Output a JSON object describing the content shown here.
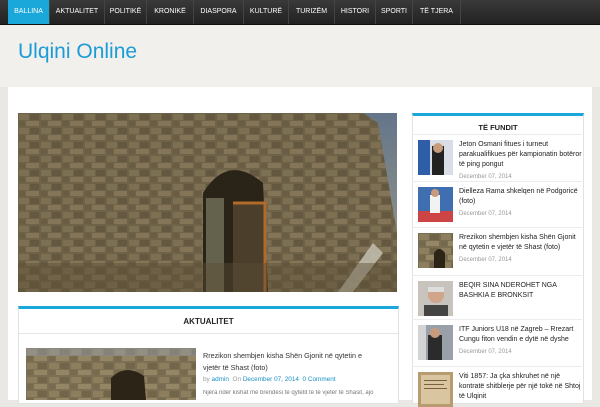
{
  "nav": {
    "items": [
      "BALLINA",
      "AKTUALITET",
      "POLITIKË",
      "KRONIKË",
      "DIASPORA",
      "KULTURË",
      "TURIZËM",
      "HISTORI",
      "SPORTI",
      "TË TJERA"
    ],
    "active_index": 0,
    "active_color": "#1aa7d9"
  },
  "site": {
    "title": "Ulqini Online",
    "title_color": "#1b9cd6"
  },
  "hero": {
    "image": "stone-ruin-photo"
  },
  "section": {
    "title": "AKTUALITET",
    "article": {
      "title": "Rrezikon shembjen kisha Shën Gjonit në qytetin e vjetër të Shast (foto)",
      "by": "by",
      "author": "admin",
      "on": "On",
      "date": "December 07, 2014",
      "comments": "0 Comment",
      "excerpt": "Njëra ndër kishat më brendësi të qytetit të të vjetër të Shasit, ajo"
    }
  },
  "sidebar": {
    "title": "TË FUNDIT",
    "items": [
      {
        "title": "Jeton Osmani fitues i turneut parakualifikues për kampionatin botëror të ping pongut",
        "date": "December 07, 2014",
        "thumb": "table-tennis-photo"
      },
      {
        "title": "Dielleza Rama shkelqen në Podgoricë (foto)",
        "date": "December 07, 2014",
        "thumb": "karate-photo"
      },
      {
        "title": "Rrezikon shembjen kisha Shën Gjonit në qytetin e vjetër të Shast (foto)",
        "date": "December 07, 2014",
        "thumb": "ruin-photo"
      },
      {
        "title": "BEQIR SINA NDEROHET NGA BASHKIA E BRONKSIT",
        "date": "December 07, 2014",
        "thumb": "portrait-photo"
      },
      {
        "title": "ITF Juniors U18 në Zagreb – Rrezart Cungu fiton vendin e dytë në dyshe",
        "date": "December 07, 2014",
        "thumb": "tennis-player-photo"
      },
      {
        "title": "Viti 1857: Ja çka shkruhet në një kontratë shitblerje për një tokë në Shtoj të Ulqinit",
        "date": "",
        "thumb": "document-photo"
      }
    ]
  }
}
